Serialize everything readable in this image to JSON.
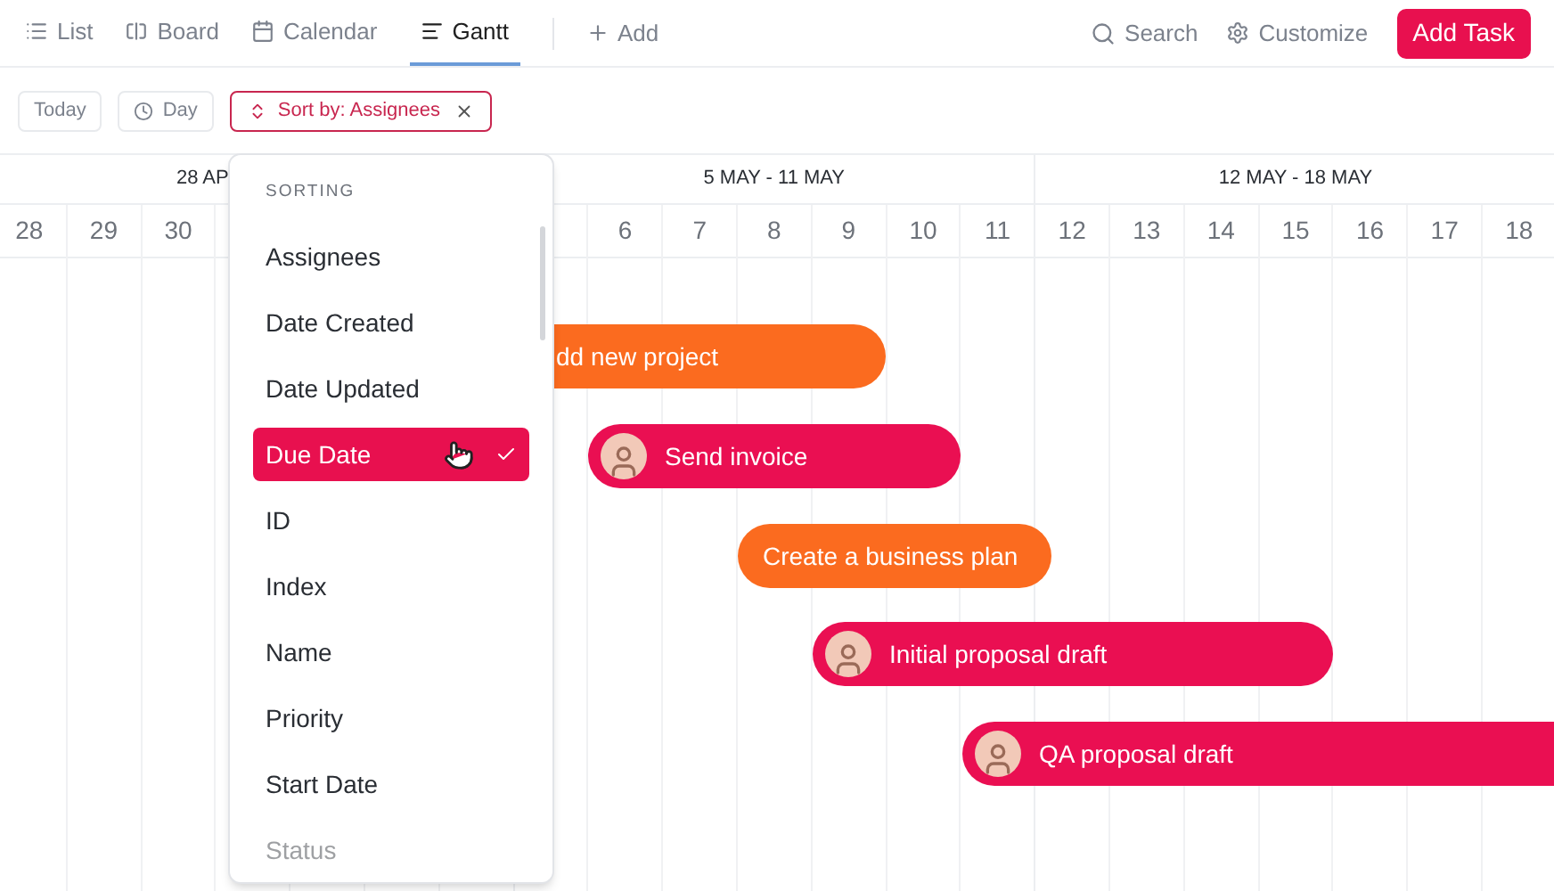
{
  "views": [
    {
      "label": "List",
      "selected": false
    },
    {
      "label": "Board",
      "selected": false
    },
    {
      "label": "Calendar",
      "selected": false
    },
    {
      "label": "Gantt",
      "selected": true
    }
  ],
  "add_view": "Add",
  "search": "Search",
  "customize": "Customize",
  "add_task": "Add Task",
  "filters": {
    "today": "Today",
    "zoom": "Day",
    "sort": "Sort by: Assignees"
  },
  "weeks": [
    {
      "label": "28 AP",
      "days": [
        "28",
        "29",
        "30"
      ]
    },
    {
      "label": "5 MAY - 11 MAY",
      "days": [
        "6",
        "7",
        "8",
        "9",
        "10",
        "11"
      ]
    },
    {
      "label": "12 MAY - 18 MAY",
      "days": [
        "12",
        "13",
        "14",
        "15",
        "16",
        "17",
        "18"
      ]
    }
  ],
  "tasks": [
    {
      "name": "dd new project",
      "color": "#fb6b1f",
      "avatar": false
    },
    {
      "name": "Send invoice",
      "color": "#ea0f52",
      "avatar": true
    },
    {
      "name": "Create a business plan",
      "color": "#fb6b1f",
      "avatar": false
    },
    {
      "name": "Initial proposal draft",
      "color": "#ea0f52",
      "avatar": true
    },
    {
      "name": "QA proposal draft",
      "color": "#ea0f52",
      "avatar": true
    }
  ],
  "sort_menu": {
    "heading": "SORTING",
    "options": [
      {
        "label": "Assignees",
        "selected": false,
        "faded": false
      },
      {
        "label": "Date Created",
        "selected": false,
        "faded": false
      },
      {
        "label": "Date Updated",
        "selected": false,
        "faded": false
      },
      {
        "label": "Due Date",
        "selected": true,
        "faded": false
      },
      {
        "label": "ID",
        "selected": false,
        "faded": false
      },
      {
        "label": "Index",
        "selected": false,
        "faded": false
      },
      {
        "label": "Name",
        "selected": false,
        "faded": false
      },
      {
        "label": "Priority",
        "selected": false,
        "faded": false
      },
      {
        "label": "Start Date",
        "selected": false,
        "faded": false
      },
      {
        "label": "Status",
        "selected": false,
        "faded": true
      }
    ]
  }
}
